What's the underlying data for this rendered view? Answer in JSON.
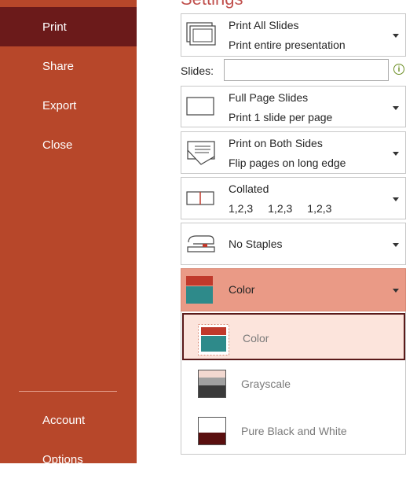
{
  "sidebar": {
    "items": [
      {
        "label": "Print"
      },
      {
        "label": "Share"
      },
      {
        "label": "Export"
      },
      {
        "label": "Close"
      },
      {
        "label": "Account"
      },
      {
        "label": "Options"
      }
    ]
  },
  "settings": {
    "heading": "Settings",
    "print_range": {
      "title": "Print All Slides",
      "subtitle": "Print entire presentation",
      "icon": "print-all-slides-icon"
    },
    "slides_label": "Slides:",
    "slides_value": "",
    "layout": {
      "title": "Full Page Slides",
      "subtitle": "Print 1 slide per page",
      "icon": "full-page-slide-icon"
    },
    "sides": {
      "title": "Print on Both Sides",
      "subtitle": "Flip pages on long edge",
      "icon": "duplex-icon"
    },
    "collation": {
      "title": "Collated",
      "sequence": [
        "1,2,3",
        "1,2,3",
        "1,2,3"
      ],
      "icon": "collated-icon"
    },
    "staples": {
      "title": "No Staples",
      "icon": "stapler-icon"
    },
    "color": {
      "selected": "Color",
      "icon": "color-swatch-icon"
    },
    "color_options": [
      {
        "label": "Color",
        "selected": true
      },
      {
        "label": "Grayscale",
        "selected": false
      },
      {
        "label": "Pure Black and White",
        "selected": false
      }
    ]
  },
  "colors": {
    "sidebar": "#b7472a",
    "sidebar_selected": "#6b1a1a",
    "accent": "#c0504d",
    "color_dropdown_bg": "#ea9a86"
  }
}
